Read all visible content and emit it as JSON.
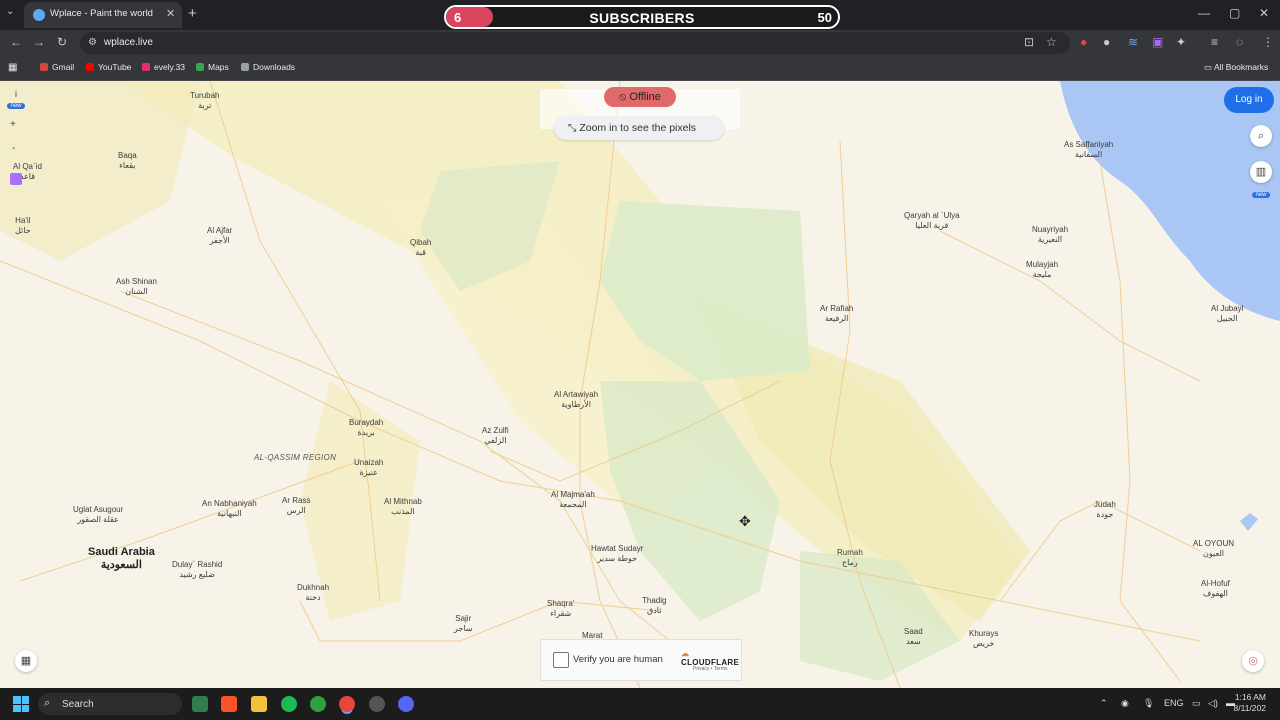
{
  "browser": {
    "tab_title": "Wplace - Paint the world",
    "tab_close": "✕",
    "new_tab": "+",
    "url": "wplace.live",
    "window_controls": {
      "minimize": "—",
      "maximize": "▢",
      "close": "✕"
    },
    "bookmarks": [
      {
        "label": "Gmail",
        "color": "#d44638"
      },
      {
        "label": "YouTube",
        "color": "#ff0000"
      },
      {
        "label": "evely.33",
        "color": "#e1306c"
      },
      {
        "label": "Maps",
        "color": "#34a853"
      },
      {
        "label": "Downloads",
        "color": "#9aa0a6"
      }
    ],
    "all_bookmarks": "All Bookmarks"
  },
  "overlay": {
    "current": "6",
    "label": "SUBSCRIBERS",
    "goal": "50",
    "progress": 0.12
  },
  "map": {
    "offline_label": "Offline",
    "zoom_hint": "Zoom in to see the pixels",
    "login_label": "Log in",
    "left_controls": {
      "info": "i",
      "new_badge": "new",
      "zoom_in": "+",
      "zoom_out": "-"
    },
    "right_new_badge": "new",
    "region_label": "AL-QASSIM REGION",
    "country": {
      "en": "Saudi Arabia",
      "ar": "السعودية"
    },
    "places": [
      {
        "en": "Turubah",
        "ar": "تربة"
      },
      {
        "en": "Baqa",
        "ar": "بقعاء"
      },
      {
        "en": "Al Qa`id",
        "ar": "قاعد"
      },
      {
        "en": "Ha'il",
        "ar": "حائل"
      },
      {
        "en": "Al Ajfar",
        "ar": "الأجفر"
      },
      {
        "en": "Qibah",
        "ar": "قبة"
      },
      {
        "en": "Ash Shinan",
        "ar": "الشنان"
      },
      {
        "en": "Al Artawiyah",
        "ar": "الأرطاوية"
      },
      {
        "en": "Buraydah",
        "ar": "بريدة"
      },
      {
        "en": "Az Zulfi",
        "ar": "الزلفي"
      },
      {
        "en": "Unaizah",
        "ar": "عنيزة"
      },
      {
        "en": "Al Majma'ah",
        "ar": "المجمعة"
      },
      {
        "en": "Uglat Asugour",
        "ar": "عقلة الصقور"
      },
      {
        "en": "An Nabhaniyah",
        "ar": "النبهانية"
      },
      {
        "en": "Ar Rass",
        "ar": "الرس"
      },
      {
        "en": "Al Mithnab",
        "ar": "المذنب"
      },
      {
        "en": "Hawtat Sudayr",
        "ar": "حوطة سدير"
      },
      {
        "en": "Dulay` Rashid",
        "ar": "ضليع رشيد"
      },
      {
        "en": "Dukhnah",
        "ar": "دخنة"
      },
      {
        "en": "Sajir",
        "ar": "ساجر"
      },
      {
        "en": "Shaqra'",
        "ar": "شقراء"
      },
      {
        "en": "Thadig",
        "ar": "ثادق"
      },
      {
        "en": "Marat",
        "ar": ""
      },
      {
        "en": "Rumah",
        "ar": "رماح"
      },
      {
        "en": "Ar Rafiah",
        "ar": "الرفيعة"
      },
      {
        "en": "Qaryah al `Ulya",
        "ar": "قرية العليا"
      },
      {
        "en": "Nuayriyah",
        "ar": "النعيرية"
      },
      {
        "en": "Mulayjah",
        "ar": "مليجة"
      },
      {
        "en": "As Saffaniyah",
        "ar": "السفانية"
      },
      {
        "en": "Al Jubayl",
        "ar": "الجبيل"
      },
      {
        "en": "Judah",
        "ar": "جودة"
      },
      {
        "en": "AL OYOUN",
        "ar": "العيون"
      },
      {
        "en": "Al-Hofuf",
        "ar": "الهفوف"
      },
      {
        "en": "Saad",
        "ar": "سعد"
      },
      {
        "en": "Khurays",
        "ar": "خريص"
      }
    ],
    "captcha": {
      "text": "Verify you are human",
      "brand": "CLOUDFLARE",
      "privacy": "Privacy",
      "sep": "•",
      "terms": "Terms"
    }
  },
  "taskbar": {
    "search": "Search",
    "lang": "ENG",
    "time": "1:16 AM",
    "date": "8/11/202"
  }
}
